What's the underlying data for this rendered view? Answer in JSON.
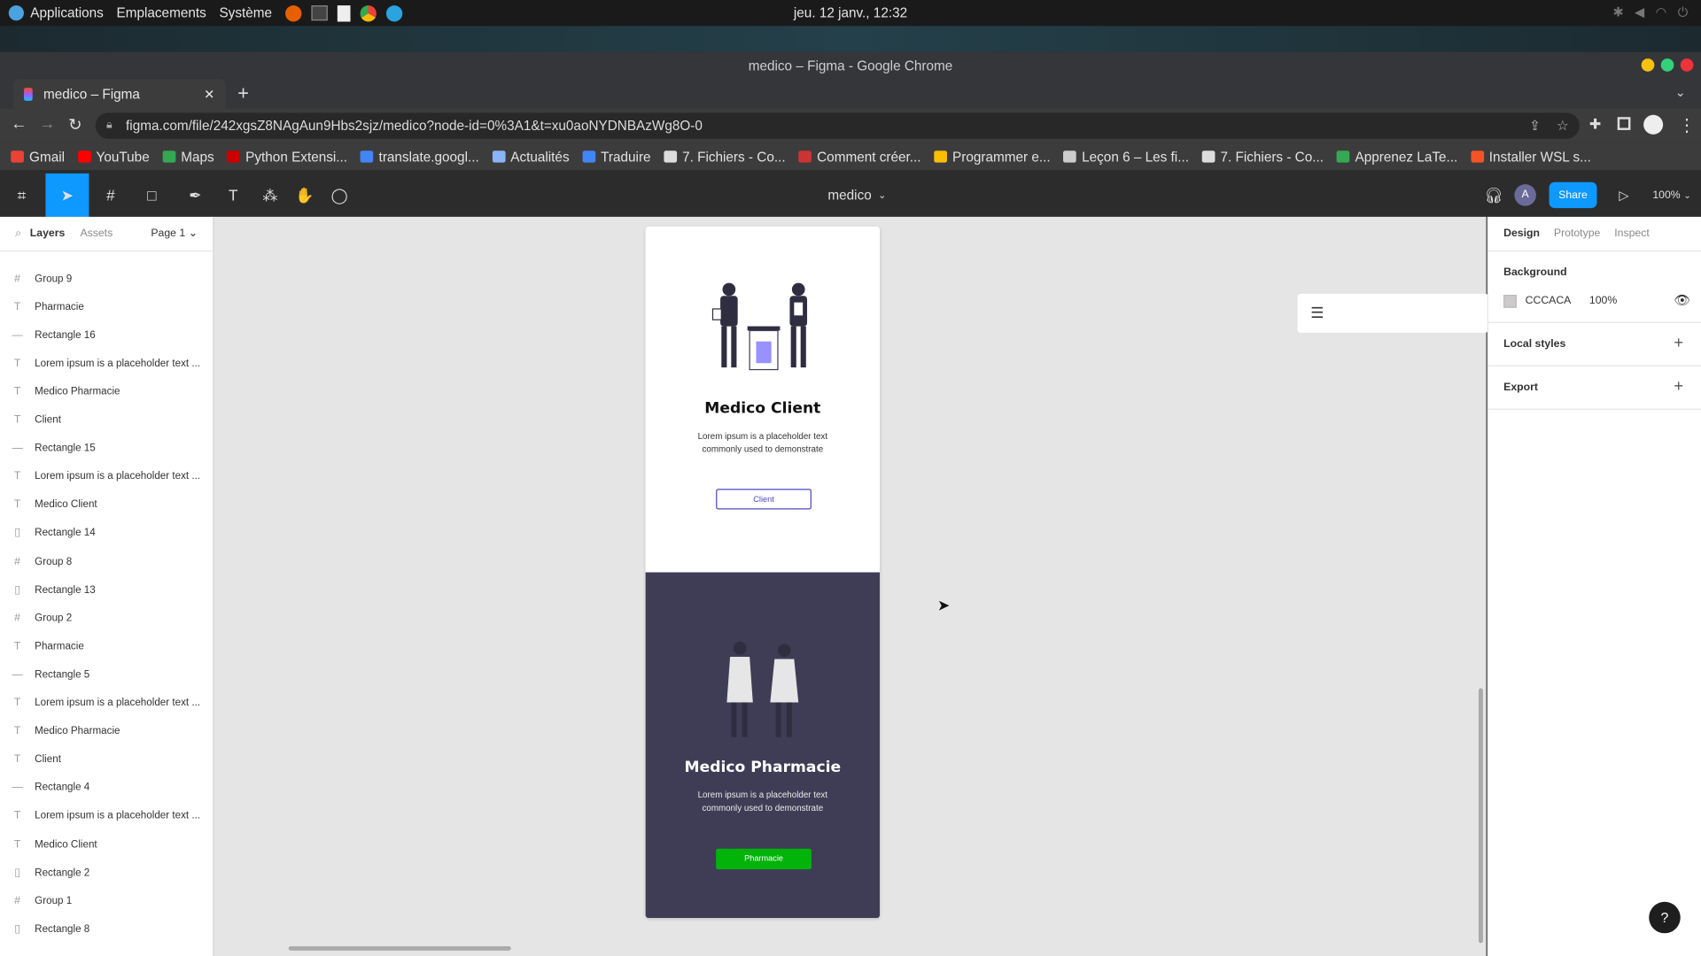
{
  "os": {
    "menu": [
      "Applications",
      "Emplacements",
      "Système"
    ],
    "clock": "jeu. 12 janv., 12:32"
  },
  "browser": {
    "window_title": "medico – Figma - Google Chrome",
    "tab_title": "medico – Figma",
    "url": "figma.com/file/242xgsZ8NAgAun9Hbs2sjz/medico?node-id=0%3A1&t=xu0aoNYDNBAzWg8O-0",
    "bookmarks": [
      {
        "label": "Gmail",
        "color": "#ea4335"
      },
      {
        "label": "YouTube",
        "color": "#ff0000"
      },
      {
        "label": "Maps",
        "color": "#34a853"
      },
      {
        "label": "Python Extensi...",
        "color": "#c00"
      },
      {
        "label": "translate.googl...",
        "color": "#4285f4"
      },
      {
        "label": "Actualités",
        "color": "#8ab4f8"
      },
      {
        "label": "Traduire",
        "color": "#4285f4"
      },
      {
        "label": "7. Fichiers - Co...",
        "color": "#ddd"
      },
      {
        "label": "Comment créer...",
        "color": "#c33"
      },
      {
        "label": "Programmer e...",
        "color": "#fbbc05"
      },
      {
        "label": "Leçon 6 – Les fi...",
        "color": "#ccc"
      },
      {
        "label": "7. Fichiers - Co...",
        "color": "#ddd"
      },
      {
        "label": "Apprenez LaTe...",
        "color": "#34a853"
      },
      {
        "label": "Installer WSL s...",
        "color": "#f35325"
      }
    ]
  },
  "figma": {
    "file_name": "medico",
    "share": "Share",
    "zoom": "100%",
    "avatar": "A",
    "left_tabs": {
      "layers": "Layers",
      "assets": "Assets",
      "page": "Page 1"
    },
    "layers": [
      {
        "icon": "#",
        "label": "Group 9"
      },
      {
        "icon": "T",
        "label": "Pharmacie"
      },
      {
        "icon": "—",
        "label": "Rectangle 16"
      },
      {
        "icon": "T",
        "label": "Lorem ipsum is a placeholder text ..."
      },
      {
        "icon": "T",
        "label": "Medico Pharmacie"
      },
      {
        "icon": "T",
        "label": "Client"
      },
      {
        "icon": "—",
        "label": "Rectangle 15"
      },
      {
        "icon": "T",
        "label": "Lorem ipsum is a placeholder text ..."
      },
      {
        "icon": "T",
        "label": "Medico Client"
      },
      {
        "icon": "▯",
        "label": "Rectangle 14"
      },
      {
        "icon": "#",
        "label": "Group 8"
      },
      {
        "icon": "▯",
        "label": "Rectangle 13"
      },
      {
        "icon": "#",
        "label": "Group 2"
      },
      {
        "icon": "T",
        "label": "Pharmacie"
      },
      {
        "icon": "—",
        "label": "Rectangle 5"
      },
      {
        "icon": "T",
        "label": "Lorem ipsum is a placeholder text ..."
      },
      {
        "icon": "T",
        "label": "Medico Pharmacie"
      },
      {
        "icon": "T",
        "label": "Client"
      },
      {
        "icon": "—",
        "label": "Rectangle 4"
      },
      {
        "icon": "T",
        "label": "Lorem ipsum is a placeholder text ..."
      },
      {
        "icon": "T",
        "label": "Medico Client"
      },
      {
        "icon": "▯",
        "label": "Rectangle 2"
      },
      {
        "icon": "#",
        "label": "Group 1"
      },
      {
        "icon": "▯",
        "label": "Rectangle 8"
      }
    ],
    "right_tabs": {
      "design": "Design",
      "prototype": "Prototype",
      "inspect": "Inspect"
    },
    "background": {
      "label": "Background",
      "hex": "CCCACA",
      "opacity": "100%"
    },
    "local_styles": "Local styles",
    "export": "Export",
    "frame_top": {
      "title": "Medico Client",
      "desc": "Lorem ipsum is a placeholder text commonly used to demonstrate",
      "button": "Client"
    },
    "frame_bottom": {
      "title": "Medico Pharmacie",
      "desc": "Lorem ipsum is a placeholder text commonly used to demonstrate",
      "button": "Pharmacie"
    },
    "help": "?"
  },
  "colors": {
    "accent": "#0d99ff",
    "dark_panel": "#3f3d56",
    "green": "#02b30a",
    "client_border": "#4a46c9"
  }
}
